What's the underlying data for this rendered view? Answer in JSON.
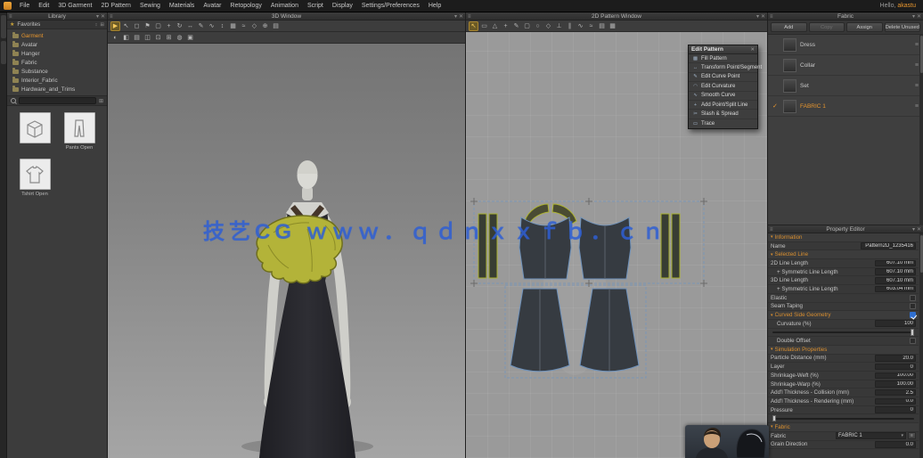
{
  "glyphs": {
    "menu": "≡",
    "chevron_down": "▾",
    "close": "✕",
    "star": "★",
    "sort": "↕",
    "grid": "⊞",
    "check": "✓"
  },
  "menubar": {
    "items": [
      "File",
      "Edit",
      "3D Garment",
      "2D Pattern",
      "Sewing",
      "Materials",
      "Avatar",
      "Retopology",
      "Animation",
      "Script",
      "Display",
      "Settings/Preferences",
      "Help"
    ],
    "greeting_prefix": "Hello,",
    "username": "akastu"
  },
  "library": {
    "title": "Library",
    "favorites": "Favorites",
    "folders": [
      {
        "label": "Garment",
        "active": true
      },
      {
        "label": "Avatar"
      },
      {
        "label": "Hanger"
      },
      {
        "label": "Fabric"
      },
      {
        "label": "Substance"
      },
      {
        "label": "Interior_Fabric"
      },
      {
        "label": "Hardware_and_Trims"
      }
    ],
    "thumbs": [
      {
        "label": ""
      },
      {
        "label": "Pants Open"
      },
      {
        "label": "Tshirt Open"
      }
    ]
  },
  "viewport3d": {
    "title": "3D Window"
  },
  "viewport2d": {
    "title": "2D Pattern Window"
  },
  "toolbar3d_main": [
    {
      "name": "simulate-icon",
      "glyph": "▶",
      "active": true
    },
    {
      "name": "select-move-icon",
      "glyph": "↖"
    },
    {
      "name": "select-mesh-icon",
      "glyph": "◻"
    },
    {
      "name": "pin-tool-icon",
      "glyph": "⚑"
    },
    {
      "name": "arrangement-icon",
      "glyph": "▢"
    },
    {
      "name": "move-gizmo-icon",
      "glyph": "+"
    },
    {
      "name": "rotate-gizmo-icon",
      "glyph": "↻"
    },
    {
      "name": "scale-gizmo-icon",
      "glyph": "↔"
    },
    {
      "name": "pen-3d-icon",
      "glyph": "✎"
    },
    {
      "name": "sewing-tool-icon",
      "glyph": "∿"
    },
    {
      "name": "measure-tool-icon",
      "glyph": "↕"
    },
    {
      "name": "flatten-tool-icon",
      "glyph": "▦"
    },
    {
      "name": "steam-tool-icon",
      "glyph": "≈"
    },
    {
      "name": "fold-tool-icon",
      "glyph": "◇"
    },
    {
      "name": "tack-tool-icon",
      "glyph": "⊕"
    },
    {
      "name": "grade-tool-icon",
      "glyph": "▤"
    }
  ],
  "toolbar3d_display": [
    {
      "name": "show-avatar-icon",
      "glyph": "◐"
    },
    {
      "name": "show-garment-icon",
      "glyph": "◧"
    },
    {
      "name": "texture-view-icon",
      "glyph": "▤"
    },
    {
      "name": "mesh-view-icon",
      "glyph": "◫"
    },
    {
      "name": "strain-map-icon",
      "glyph": "⊡"
    },
    {
      "name": "grid-view-icon",
      "glyph": "⊞"
    },
    {
      "name": "light-view-icon",
      "glyph": "◍"
    },
    {
      "name": "shadow-view-icon",
      "glyph": "▣"
    }
  ],
  "toolbar2d": [
    {
      "name": "transform-pattern-icon",
      "glyph": "↖",
      "active": true
    },
    {
      "name": "edit-pattern-icon",
      "glyph": "▭"
    },
    {
      "name": "edit-point-icon",
      "glyph": "△"
    },
    {
      "name": "add-point-icon",
      "glyph": "+"
    },
    {
      "name": "pen-2d-icon",
      "glyph": "✎"
    },
    {
      "name": "rectangle-tool-icon",
      "glyph": "▢"
    },
    {
      "name": "circle-tool-icon",
      "glyph": "○"
    },
    {
      "name": "dart-tool-icon",
      "glyph": "◇"
    },
    {
      "name": "notch-tool-icon",
      "glyph": "⊥"
    },
    {
      "name": "internal-line-icon",
      "glyph": "∥"
    },
    {
      "name": "free-sewing-icon",
      "glyph": "∿"
    },
    {
      "name": "segment-sewing-icon",
      "glyph": "≈"
    },
    {
      "name": "grading-icon",
      "glyph": "▤"
    },
    {
      "name": "texture-editor-icon",
      "glyph": "▦"
    }
  ],
  "context_menu": {
    "title": "Edit Pattern",
    "items": [
      {
        "glyph": "▩",
        "label": "Fill Pattern"
      },
      {
        "glyph": "↔",
        "label": "Transform Point/Segment"
      },
      {
        "glyph": "✎",
        "label": "Edit Curve Point"
      },
      {
        "glyph": "◠",
        "label": "Edit Curvature"
      },
      {
        "glyph": "∿",
        "label": "Smooth Curve"
      },
      {
        "glyph": "+",
        "label": "Add Point/Split Line"
      },
      {
        "glyph": "✂",
        "label": "Slash & Spread"
      },
      {
        "glyph": "▭",
        "label": "Trace"
      }
    ]
  },
  "object_browser": {
    "title": "Fabric",
    "buttons": [
      {
        "label": "Add"
      },
      {
        "label": "Copy",
        "disabled": true
      },
      {
        "label": "Assign"
      },
      {
        "label": "Delete Unused"
      }
    ],
    "rows": [
      {
        "name": "Dress"
      },
      {
        "name": "Collar"
      },
      {
        "name": "Set"
      },
      {
        "name": "FABRIC 1",
        "active": true
      }
    ]
  },
  "property_editor": {
    "title": "Property Editor",
    "info_header": "Information",
    "info_rows": [
      {
        "label": "Name",
        "value": "Pattern2D_1235416"
      }
    ],
    "line_header": "Selected Line",
    "line_rows": [
      {
        "label": "2D Line Length",
        "value": "607.10 mm"
      },
      {
        "label": "+ Symmetric Line Length",
        "value": "607.10 mm",
        "indent": true
      },
      {
        "label": "3D Line Length",
        "value": "607.10 mm"
      },
      {
        "label": "+ Symmetric Line Length",
        "value": "603.04 mm",
        "indent": true
      }
    ],
    "toggle_rows": [
      {
        "label": "Elastic"
      },
      {
        "label": "Seam Taping"
      }
    ],
    "curved_header": "Curved Side Geometry",
    "curvature_label": "Curvature (%)",
    "curvature_value": "100",
    "double_label": "Double Offset",
    "sim_header": "Simulation Properties",
    "sim_rows": [
      {
        "label": "Particle Distance (mm)",
        "value": "20.0"
      },
      {
        "label": "Layer",
        "value": "0"
      },
      {
        "label": "Shrinkage-Weft (%)",
        "value": "100.00"
      },
      {
        "label": "Shrinkage-Warp (%)",
        "value": "100.00"
      },
      {
        "label": "Add'l Thickness - Collision (mm)",
        "value": "2.5"
      },
      {
        "label": "Add'l Thickness - Rendering (mm)",
        "value": "0.0"
      }
    ],
    "pressure_label": "Pressure",
    "pressure_value": "0",
    "fabric_header": "Fabric",
    "fabric_label": "Fabric",
    "fabric_value": "FABRIC 1",
    "grain_label": "Grain Direction",
    "grain_value": "0.0"
  },
  "watermark": {
    "text": "技艺CG ｗｗｗ．ｑｄｎｘｘｆｂ．ｃｎ"
  }
}
